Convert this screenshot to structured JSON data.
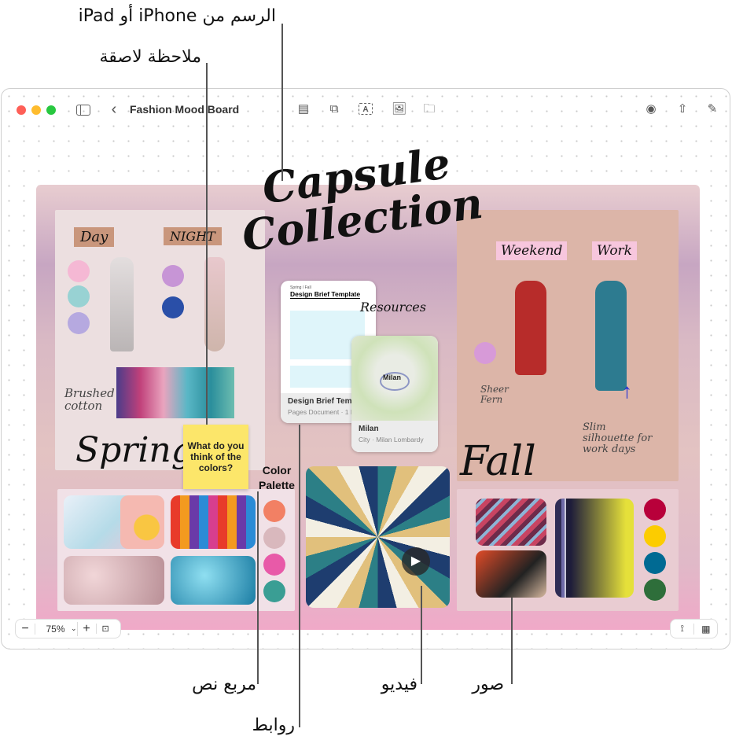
{
  "callouts": {
    "drawing": "الرسم من iPhone أو iPad",
    "sticky_note": "ملاحظة لاصقة",
    "text_box": "مربع نص",
    "links": "روابط",
    "video": "فيديو",
    "images": "صور"
  },
  "window": {
    "title": "Fashion Mood Board",
    "traffic_lights": {
      "close": "#fe5f57",
      "minimize": "#febc2e",
      "maximize": "#28c840"
    },
    "toolbar_icons": [
      "sidebar-icon",
      "back-chevron-icon",
      "text-list-icon",
      "shapes-icon",
      "text-box-icon",
      "media-icon",
      "folder-icon",
      "collaborate-icon",
      "share-icon",
      "compose-icon"
    ]
  },
  "board": {
    "title_handwritten": "Capsule Collection",
    "left_panel": {
      "labels": [
        "Day",
        "NIGHT"
      ],
      "note": "Brushed cotton",
      "season": "Spring"
    },
    "right_panel": {
      "labels": [
        "Weekend",
        "Work"
      ],
      "note1": "Sheer Fern",
      "note2": "Slim silhouette for work days",
      "season": "Fall"
    },
    "resources_label": "Resources",
    "sticky_note": {
      "text": "What do you think of the colors?",
      "color": "#fce66a"
    },
    "text_box": "Color Palette",
    "palette_left": [
      "#f28064",
      "#d9b8bd",
      "#e85aa8",
      "#3a9e94"
    ],
    "palette_right": [
      "#b8003a",
      "#fccc00",
      "#006a93",
      "#2e6e3a"
    ],
    "links": [
      {
        "preview_header": "Spring / Fall",
        "preview_title": "Design Brief Template",
        "title": "Design Brief Template",
        "subtitle": "Pages Document · 1 MB"
      },
      {
        "map_label": "Milan",
        "title": "Milan",
        "subtitle": "City · Milan Lombardy"
      }
    ]
  },
  "zoom_control": {
    "minus": "−",
    "value": "75%",
    "plus": "+"
  },
  "bottom_right_icons": [
    "connector-icon",
    "grid-icon"
  ]
}
